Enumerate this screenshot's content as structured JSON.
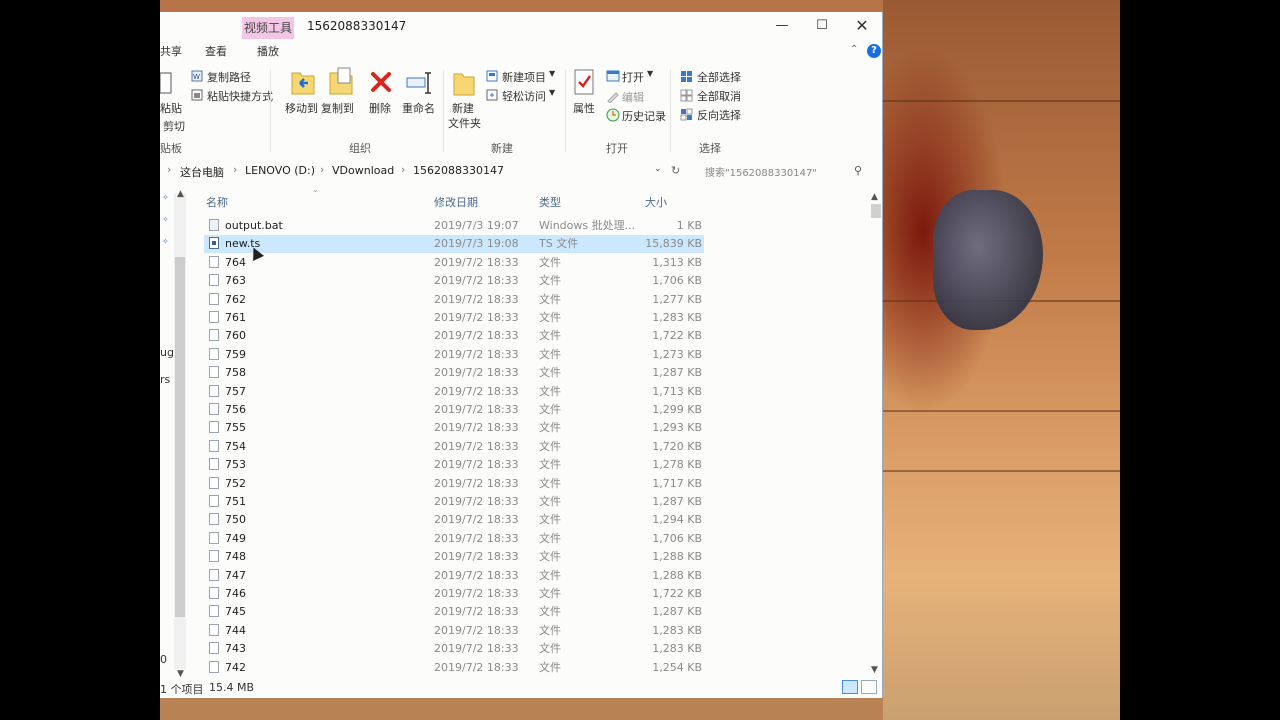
{
  "window": {
    "title": "1562088330147",
    "context_tab": "视频工具",
    "ribbon_tabs": [
      "共享",
      "查看",
      "播放"
    ]
  },
  "ribbon": {
    "clipboard": {
      "paste_label": "粘贴",
      "cut_label": "剪切",
      "copy_path": "复制路径",
      "paste_shortcut": "粘贴快捷方式",
      "group": "贴板"
    },
    "organize": {
      "move_to": "移动到",
      "copy_to": "复制到",
      "delete": "删除",
      "rename": "重命名",
      "group": "组织"
    },
    "new": {
      "new_folder_l1": "新建",
      "new_folder_l2": "文件夹",
      "new_item": "新建项目",
      "easy_access": "轻松访问",
      "group": "新建"
    },
    "open": {
      "properties": "属性",
      "open": "打开",
      "edit": "编辑",
      "history": "历史记录",
      "group": "打开"
    },
    "select": {
      "select_all": "全部选择",
      "select_none": "全部取消",
      "invert": "反向选择",
      "group": "选择"
    }
  },
  "address": {
    "crumbs": [
      "这台电脑",
      "LENOVO (D:)",
      "VDownload",
      "1562088330147"
    ],
    "search_placeholder": "搜索\"1562088330147\""
  },
  "nav_fragments": [
    "ug",
    "rs",
    "0"
  ],
  "columns": {
    "name": "名称",
    "date": "修改日期",
    "type": "类型",
    "size": "大小"
  },
  "files": [
    {
      "name": "output.bat",
      "date": "2019/7/3 19:07",
      "type": "Windows 批处理...",
      "size": "1 KB",
      "kind": "bat"
    },
    {
      "name": "new.ts",
      "date": "2019/7/3 19:08",
      "type": "TS 文件",
      "size": "15,839 KB",
      "kind": "ts",
      "selected": true
    },
    {
      "name": "764",
      "date": "2019/7/2 18:33",
      "type": "文件",
      "size": "1,313 KB"
    },
    {
      "name": "763",
      "date": "2019/7/2 18:33",
      "type": "文件",
      "size": "1,706 KB"
    },
    {
      "name": "762",
      "date": "2019/7/2 18:33",
      "type": "文件",
      "size": "1,277 KB"
    },
    {
      "name": "761",
      "date": "2019/7/2 18:33",
      "type": "文件",
      "size": "1,283 KB"
    },
    {
      "name": "760",
      "date": "2019/7/2 18:33",
      "type": "文件",
      "size": "1,722 KB"
    },
    {
      "name": "759",
      "date": "2019/7/2 18:33",
      "type": "文件",
      "size": "1,273 KB"
    },
    {
      "name": "758",
      "date": "2019/7/2 18:33",
      "type": "文件",
      "size": "1,287 KB"
    },
    {
      "name": "757",
      "date": "2019/7/2 18:33",
      "type": "文件",
      "size": "1,713 KB"
    },
    {
      "name": "756",
      "date": "2019/7/2 18:33",
      "type": "文件",
      "size": "1,299 KB"
    },
    {
      "name": "755",
      "date": "2019/7/2 18:33",
      "type": "文件",
      "size": "1,293 KB"
    },
    {
      "name": "754",
      "date": "2019/7/2 18:33",
      "type": "文件",
      "size": "1,720 KB"
    },
    {
      "name": "753",
      "date": "2019/7/2 18:33",
      "type": "文件",
      "size": "1,278 KB"
    },
    {
      "name": "752",
      "date": "2019/7/2 18:33",
      "type": "文件",
      "size": "1,717 KB"
    },
    {
      "name": "751",
      "date": "2019/7/2 18:33",
      "type": "文件",
      "size": "1,287 KB"
    },
    {
      "name": "750",
      "date": "2019/7/2 18:33",
      "type": "文件",
      "size": "1,294 KB"
    },
    {
      "name": "749",
      "date": "2019/7/2 18:33",
      "type": "文件",
      "size": "1,706 KB"
    },
    {
      "name": "748",
      "date": "2019/7/2 18:33",
      "type": "文件",
      "size": "1,288 KB"
    },
    {
      "name": "747",
      "date": "2019/7/2 18:33",
      "type": "文件",
      "size": "1,288 KB"
    },
    {
      "name": "746",
      "date": "2019/7/2 18:33",
      "type": "文件",
      "size": "1,722 KB"
    },
    {
      "name": "745",
      "date": "2019/7/2 18:33",
      "type": "文件",
      "size": "1,287 KB"
    },
    {
      "name": "744",
      "date": "2019/7/2 18:33",
      "type": "文件",
      "size": "1,283 KB"
    },
    {
      "name": "743",
      "date": "2019/7/2 18:33",
      "type": "文件",
      "size": "1,283 KB"
    },
    {
      "name": "742",
      "date": "2019/7/2 18:33",
      "type": "文件",
      "size": "1,254 KB"
    }
  ],
  "status": {
    "count": "1 个项目",
    "size": "15.4 MB"
  },
  "colors": {
    "selection": "#cce8ff",
    "context_tab": "#f4c6e6",
    "column_header": "#4c6a8c",
    "help_blue": "#1b6ee0"
  }
}
